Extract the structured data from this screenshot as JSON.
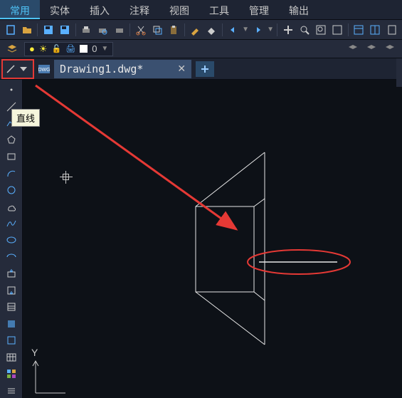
{
  "menu": {
    "items": [
      "常用",
      "实体",
      "插入",
      "注释",
      "视图",
      "工具",
      "管理",
      "输出"
    ],
    "active_index": 0
  },
  "layer": {
    "current_name": "0",
    "swatch_color": "#ffffff"
  },
  "document": {
    "tab_title": "Drawing1.dwg*"
  },
  "tooltip": {
    "line_tool": "直线"
  },
  "ucs": {
    "y_label": "Y"
  },
  "colors": {
    "highlight_red": "#e53935",
    "accent_blue": "#4fc3f7",
    "canvas_bg": "#0d1117"
  },
  "left_tools": [
    "point-tool",
    "construction-line-tool",
    "polyline-tool",
    "polygon-tool",
    "rectangle-tool",
    "arc-tool",
    "circle-tool",
    "revision-cloud-tool",
    "spline-tool",
    "ellipse-tool",
    "ellipse-arc-tool",
    "insert-block-tool",
    "make-block-tool",
    "hatch-tool",
    "gradient-tool",
    "region-tool",
    "table-tool",
    "grid-tool",
    "multiline-tool"
  ]
}
